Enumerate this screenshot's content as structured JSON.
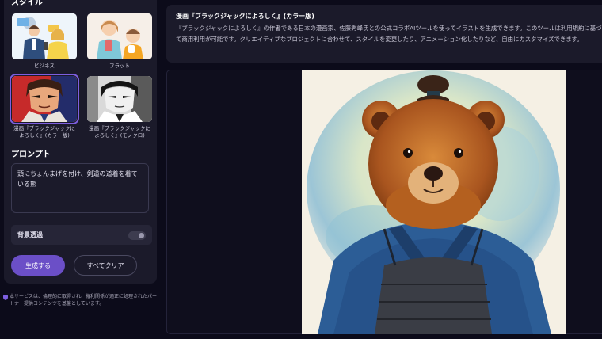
{
  "sidebar": {
    "style_section_title": "スタイル",
    "styles": [
      {
        "label": "ビジネス",
        "selected": false
      },
      {
        "label": "フラット",
        "selected": false
      },
      {
        "label": "漫画『ブラックジャックに\nよろしく』(カラー版)",
        "selected": true
      },
      {
        "label": "漫画『ブラックジャックに\nよろしく』(モノクロ)",
        "selected": false
      }
    ],
    "prompt_section_title": "プロンプト",
    "prompt_value": "頭にちょんまげを付け、剣道の道着を着ている熊",
    "background_transparent_label": "背景透過",
    "background_transparent_on": false,
    "generate_button": "生成する",
    "clear_button": "すべてクリア",
    "disclaimer": "本サービスは、倫理的に取得され、権利関係が適正に処理されたパートナー提供コンテンツを基盤としています。",
    "accent_color": "#6b4fc7"
  },
  "description": {
    "title": "漫画『ブラックジャックによろしく』(カラー版)",
    "body": "『ブラックジャックによろしく』の作者である日本の漫画家、佐藤秀峰氏との公式コラボAIツールを使ってイラストを生成できます。このツールは利用規約に基づいて商用利用が可能です。クリエイティブなプロジェクトに合わせて、スタイルを変更したり、アニメーション化したりなど、自由にカスタマイズできます。"
  }
}
